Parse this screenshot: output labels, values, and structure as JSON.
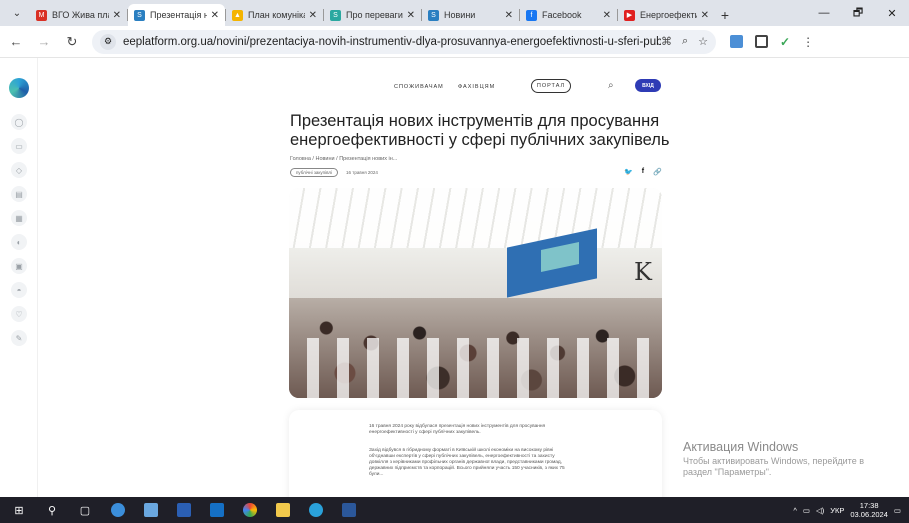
{
  "tabs": [
    {
      "title": "ВГО Жива плане",
      "favicon_color": "#d93025",
      "favicon_glyph": "M",
      "active": false
    },
    {
      "title": "Презентація н",
      "favicon_color": "#2a7fc1",
      "favicon_glyph": "S",
      "active": true
    },
    {
      "title": "План комунікац",
      "favicon_color": "#f4b400",
      "favicon_glyph": "▲",
      "active": false
    },
    {
      "title": "Про переваги",
      "favicon_color": "#2aa8a0",
      "favicon_glyph": "S",
      "active": false
    },
    {
      "title": "Новини",
      "favicon_color": "#2a7fc1",
      "favicon_glyph": "S",
      "active": false
    },
    {
      "title": "Facebook",
      "favicon_color": "#1877f2",
      "favicon_glyph": "f",
      "active": false
    },
    {
      "title": "Енергоефектив",
      "favicon_color": "#e02020",
      "favicon_glyph": "▶",
      "active": false
    }
  ],
  "window_controls": {
    "minimize": "—",
    "maximize": "🗗",
    "close": "✕"
  },
  "toolbar": {
    "url": "eeplatform.org.ua/novini/prezentaciya-novih-instrumentiv-dlya-prosuvannya-energoefektivnosti-u-sferi-publichnih-zakupivel/"
  },
  "site_header": {
    "menu": [
      "СПОЖИВАЧАМ",
      "ФАХІВЦЯМ"
    ],
    "portal_label": "ПОРТАЛ",
    "login_label": "ВХІД"
  },
  "article": {
    "title": "Презентація нових інструментів для просування енергоефективності у сфері публічних закупівель",
    "breadcrumb": "Головна / Новини / Презентація нових ін...",
    "tag": "публічні закупівлі",
    "date": "16 травня 2024",
    "paragraph1": "16 травня 2024 року відбулася презентація нових інструментів для просування енергоефективності у сфері публічних закупівель.",
    "paragraph2": "Захід відбувся в гібридному форматі в Київській школі економіки на високому рівні об'єднавши експертів у сфері публічних закупівель, енергоефективності та захисту довкілля з керівниками профільних органів державної влади, представниками громад, державних підприємств та корпорацій. Всього прийняли участь 150 учасників, з яких 75 були..."
  },
  "windows_activation": {
    "title": "Активация Windows",
    "subtitle": "Чтобы активировать Windows, перейдите в раздел \"Параметры\"."
  },
  "taskbar": {
    "tray_lang": "УКР",
    "time": "17:38",
    "date": "03.06.2024"
  }
}
